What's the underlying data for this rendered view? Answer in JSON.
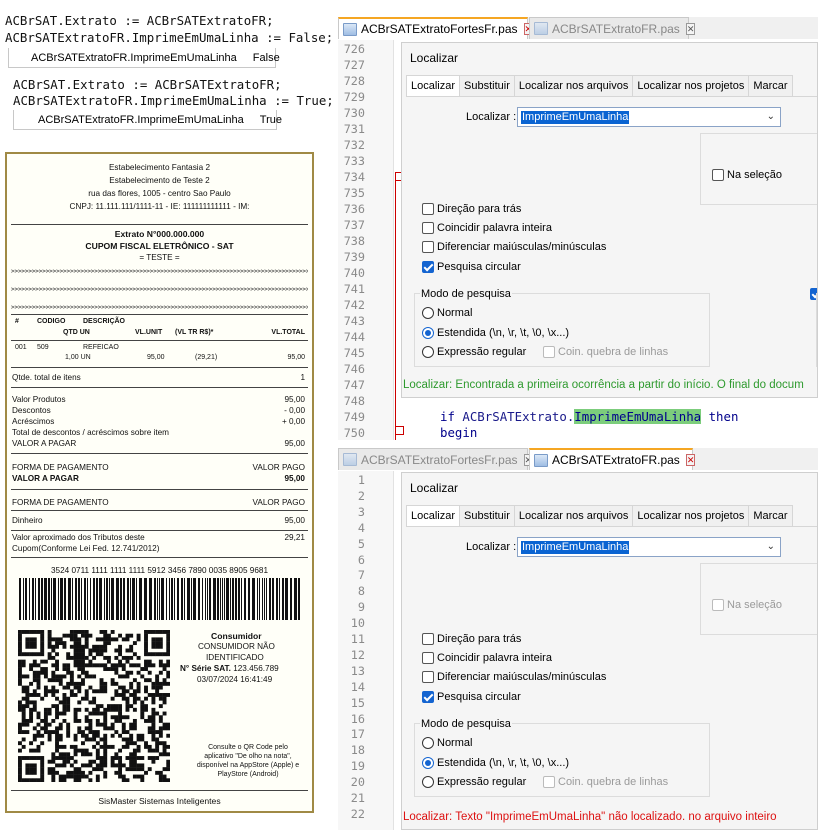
{
  "snippet1": {
    "line1": "ACBrSAT.Extrato := ACBrSATExtratoFR;",
    "line2": "ACBrSATExtratoFR.ImprimeEmUmaLinha := False;",
    "prop_name": "ACBrSATExtratoFR.ImprimeEmUmaLinha",
    "prop_value": "False"
  },
  "snippet2": {
    "line1": "ACBrSAT.Extrato := ACBrSATExtratoFR;",
    "line2": "ACBrSATExtratoFR.ImprimeEmUmaLinha := True;",
    "prop_name": "ACBrSATExtratoFR.ImprimeEmUmaLinha",
    "prop_value": "True"
  },
  "receipt": {
    "header": [
      "Estabelecimento Fantasia 2",
      "Estabelecimento de Teste 2",
      "rua das flores, 1005 - centro Sao Paulo",
      "CNPJ: 11.111.111/1111-11 - IE: 111111111111 - IM:"
    ],
    "extrato": "Extrato N°000.000.000",
    "cupom": "CUPOM FISCAL ELETRÔNICO - SAT",
    "teste": "=  TESTE  =",
    "dashes": ">>>>>>>>>>>>>>>>>>>>>>>>>>>>>>>>>>>>>>>>>>>>>>>>>>>>>>>>>>>>>>>>>>>>>>>>>>>>>>>>>>>>>>>>>>>>>>>>>>",
    "col_h1": [
      "#",
      "CODIGO",
      "DESCRIÇÃO"
    ],
    "col_h2": [
      "QTD UN",
      "VL.UNIT",
      "(VL TR R$)*",
      "VL.TOTAL"
    ],
    "item1": [
      "001",
      "509",
      "REFEICAO"
    ],
    "item2": [
      "1,00 UN",
      "95,00",
      "(29,21)",
      "95,00"
    ],
    "qtde_label": "Qtde. total de itens",
    "qtde_value": "1",
    "valor_produtos": [
      "Valor Produtos",
      "95,00"
    ],
    "descontos": [
      "Descontos",
      "- 0,00"
    ],
    "acrescimos": [
      "Acréscimos",
      "+ 0,00"
    ],
    "total_desc": "Total de descontos / acréscimos sobre item",
    "valor_pagar": [
      "VALOR A PAGAR",
      "95,00"
    ],
    "forma1": [
      "FORMA DE PAGAMENTO",
      "VALOR PAGO"
    ],
    "valor_pagar2": [
      "VALOR A PAGAR",
      "95,00"
    ],
    "forma2": [
      "FORMA DE PAGAMENTO",
      "VALOR PAGO"
    ],
    "dinheiro": [
      "Dinheiro",
      "95,00"
    ],
    "tributos1": "Valor aproximado dos Tributos deste",
    "tributos_value": "29,21",
    "tributos2": "Cupom(Conforme Lei Fed. 12.741/2012)",
    "chave": "3524 0711 1111 1111 1111 5912 3456 7890 0035 8905 9681",
    "consumidor": "Consumidor",
    "cons_nao": "CONSUMIDOR NÃO",
    "identificado": "IDENTIFICADO",
    "serie_label": "N° Série SAT.",
    "serie_value": "123.456.789",
    "datahora": "03/07/2024 16:41:49",
    "qr_text": [
      "Consulte o QR Code pelo",
      "aplicativo \"De olho na nota\",",
      "disponível na AppStore (Apple) e",
      "PlayStore (Android)"
    ],
    "footer": "SisMaster Sistemas Inteligentes"
  },
  "pane1": {
    "tab_active": "ACBrSATExtratoFortesFr.pas",
    "tab_other": "ACBrSATExtratoFR.pas",
    "close_glyph": "✕",
    "line_numbers": [
      "726",
      "727",
      "728",
      "729",
      "730",
      "731",
      "732",
      "733",
      "734",
      "735",
      "736",
      "737",
      "738",
      "739",
      "740",
      "741",
      "742",
      "743",
      "744",
      "745",
      "746",
      "747",
      "748",
      "749",
      "750"
    ],
    "code_if": "if",
    "code_obj": "ACBrSATExtrato.",
    "code_hl": "ImprimeEmUmaLinha",
    "code_then": "then",
    "code_begin": "begin",
    "status": "Localizar: Encontrada a primeira ocorrência a partir do início. O final do docum"
  },
  "pane2": {
    "tab_other": "ACBrSATExtratoFortesFr.pas",
    "tab_active": "ACBrSATExtratoFR.pas",
    "close_glyph": "✕",
    "line_numbers": [
      "1",
      "2",
      "3",
      "4",
      "5",
      "6",
      "7",
      "8",
      "9",
      "10",
      "11",
      "12",
      "13",
      "14",
      "15",
      "16",
      "17",
      "18",
      "19",
      "20",
      "21",
      "22"
    ],
    "status": "Localizar: Texto \"ImprimeEmUmaLinha\" não localizado. no arquivo inteiro"
  },
  "dialog": {
    "title": "Localizar",
    "tabs": [
      "Localizar",
      "Substituir",
      "Localizar nos arquivos",
      "Localizar nos projetos",
      "Marcar"
    ],
    "find_label": "Localizar :",
    "find_value": "ImprimeEmUmaLinha",
    "na_selecao": "Na seleção",
    "direcao": "Direção para trás",
    "coincidir": "Coincidir palavra inteira",
    "diferenciar": "Diferenciar maiúsculas/minúsculas",
    "circular": "Pesquisa circular",
    "modo": "Modo de pesquisa",
    "normal": "Normal",
    "estendida": "Estendida  (\\n, \\r, \\t, \\0, \\x...)",
    "expressao": "Expressão regular",
    "quebra": "Coin. quebra de linhas"
  },
  "colors": {
    "accent": "#1464d0",
    "ok": "#2e9a2e",
    "err": "#d11111",
    "tab_accent": "#f5a623"
  }
}
